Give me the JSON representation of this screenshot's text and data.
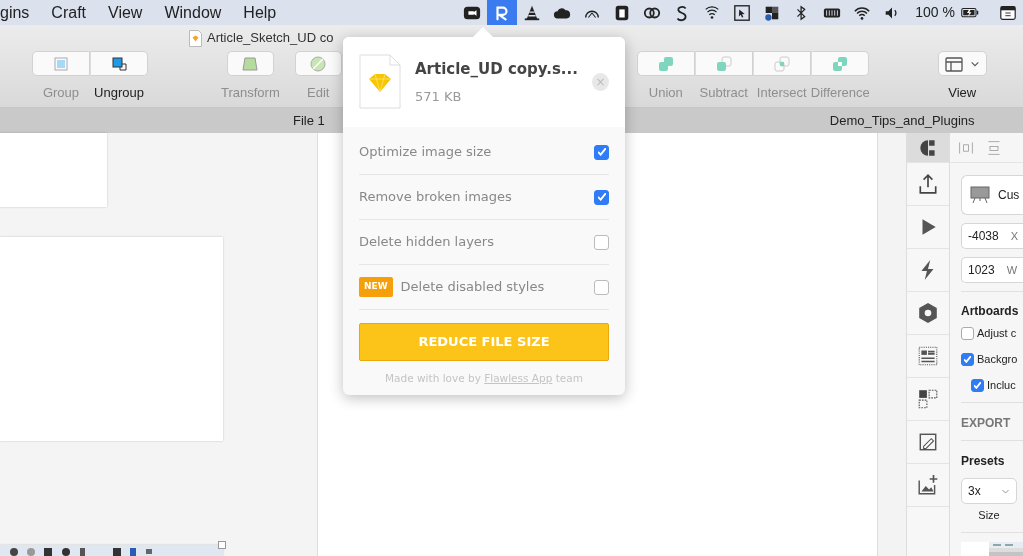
{
  "menu_bar": {
    "menus": [
      "gins",
      "Craft",
      "View",
      "Window",
      "Help"
    ],
    "battery": "100 %"
  },
  "window": {
    "title": "Article_Sketch_UD co"
  },
  "toolbar": {
    "groups": [
      [
        {
          "kind": "group",
          "label": "Group",
          "disabled": true
        },
        {
          "kind": "ungroup",
          "label": "Ungroup",
          "disabled": false
        }
      ],
      [
        {
          "kind": "transform",
          "label": "Transform",
          "disabled": true
        }
      ],
      [
        {
          "kind": "edit",
          "label": "Edit",
          "disabled": true
        }
      ],
      [
        {
          "kind": "union",
          "label": "Union",
          "disabled": true
        },
        {
          "kind": "subtract",
          "label": "Subtract",
          "disabled": true
        },
        {
          "kind": "intersect",
          "label": "Intersect",
          "disabled": true
        },
        {
          "kind": "difference",
          "label": "Difference",
          "disabled": true
        }
      ],
      [
        {
          "kind": "view",
          "label": "View",
          "disabled": false
        }
      ]
    ]
  },
  "document_tabs": [
    "File 1",
    "Demo_Tips_and_Plugins"
  ],
  "popover": {
    "file_name": "Article_UD copy.s...",
    "file_size": "571 KB",
    "close": "×",
    "options": [
      {
        "label": "Optimize image size",
        "checked": true
      },
      {
        "label": "Remove broken images",
        "checked": true
      },
      {
        "label": "Delete hidden layers",
        "checked": false
      },
      {
        "label": "Delete disabled styles",
        "checked": false,
        "badge": "NEW"
      }
    ],
    "button": "REDUCE FILE SIZE",
    "footer": {
      "before": "Made with love by",
      "link": "Flawless App",
      "after": "team"
    }
  },
  "inspector": {
    "preset_name": "Cus",
    "x_value": "-4038",
    "x_label": "X",
    "width_value": "1023",
    "width_label": "W",
    "artboards_title": "Artboards",
    "options": [
      {
        "label": "Adjust c",
        "checked": false
      },
      {
        "label": "Backgro",
        "checked": true,
        "children": [
          {
            "label": "Incluc",
            "checked": true
          }
        ]
      }
    ],
    "export_title": "EXPORT",
    "presets_title": "Presets",
    "scale": "3x",
    "size_label": "Size"
  }
}
